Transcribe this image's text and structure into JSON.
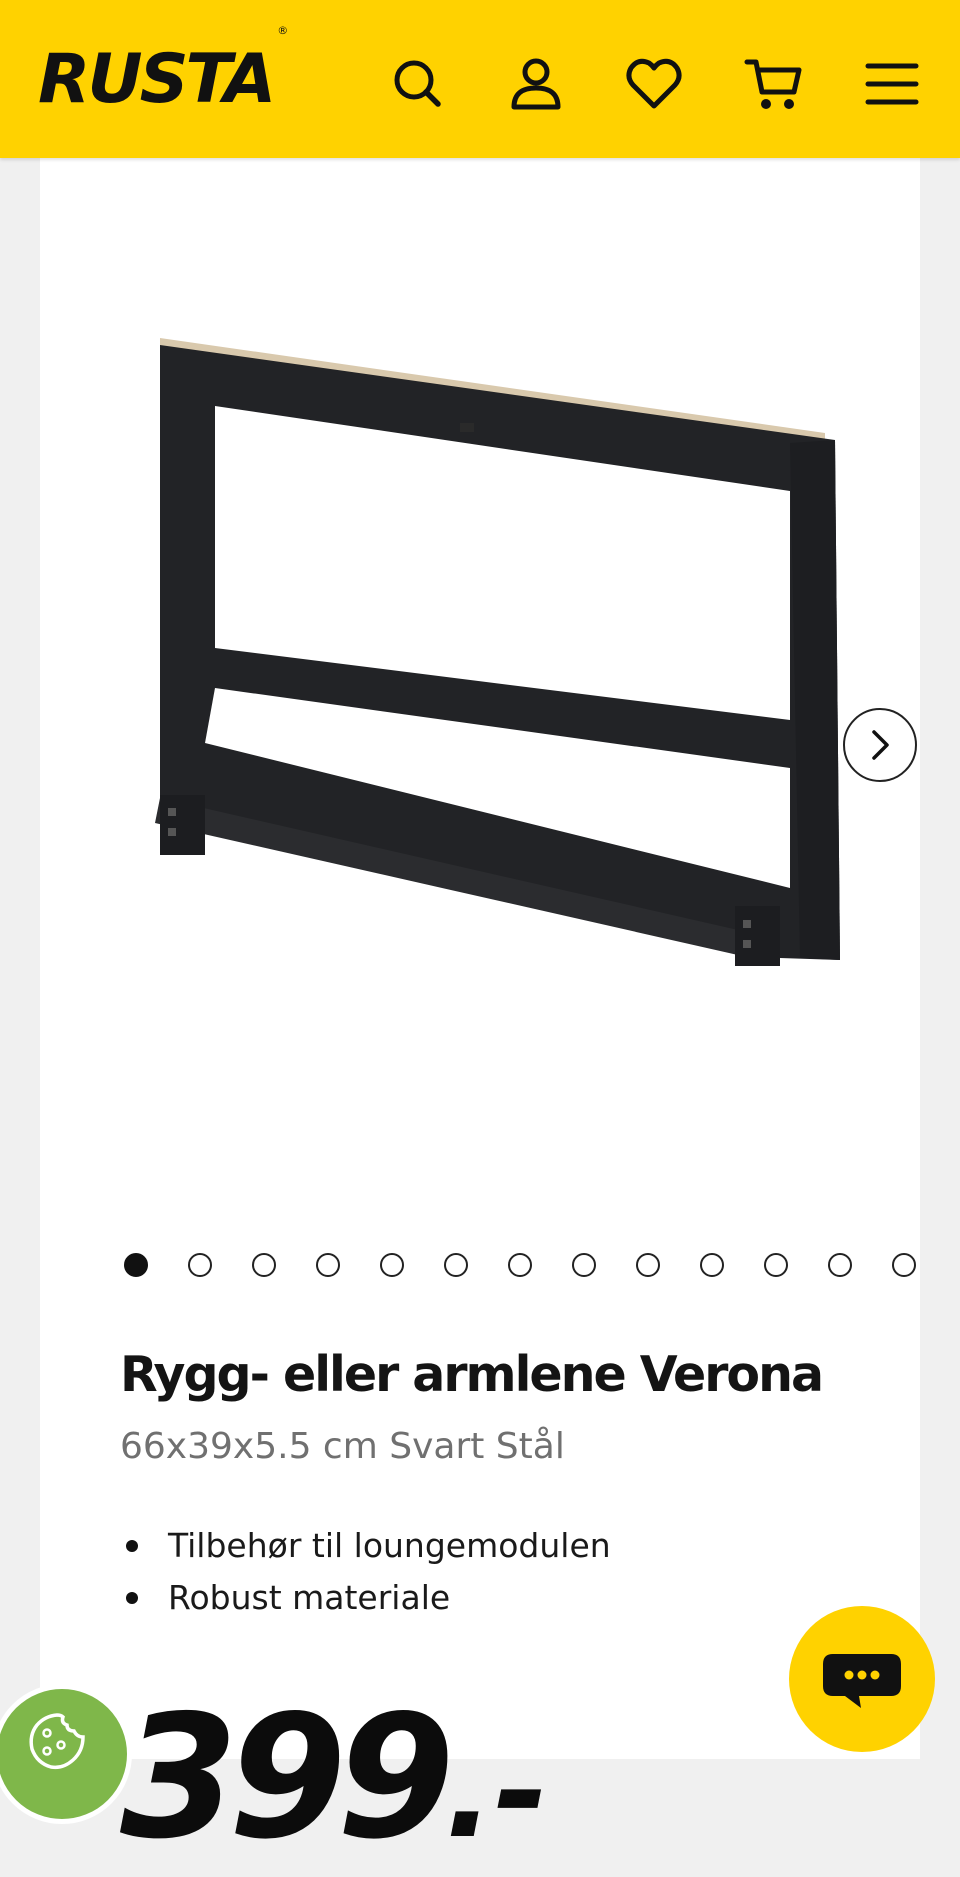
{
  "header": {
    "logo_text": "RUSTA",
    "logo_mark": "®",
    "background": "#ffd200",
    "icons": [
      "search-icon",
      "user-icon",
      "heart-icon",
      "cart-icon",
      "menu-icon"
    ]
  },
  "gallery": {
    "image_name": "product-image",
    "total_images": 13,
    "active_index": 0,
    "next_icon": "chevron-right-icon"
  },
  "product": {
    "title": "Rygg- eller armlene Verona",
    "subtitle": "66x39x5.5 cm Svart Stål",
    "features": [
      "Tilbehør til loungemodulen",
      "Robust materiale"
    ],
    "price_value": "399",
    "price_suffix": ".-"
  },
  "floating": {
    "chat_icon": "chat-bubble-icon",
    "cookie_icon": "cookie-icon",
    "chat_color": "#ffd200",
    "cookie_color": "#7fb74a"
  }
}
